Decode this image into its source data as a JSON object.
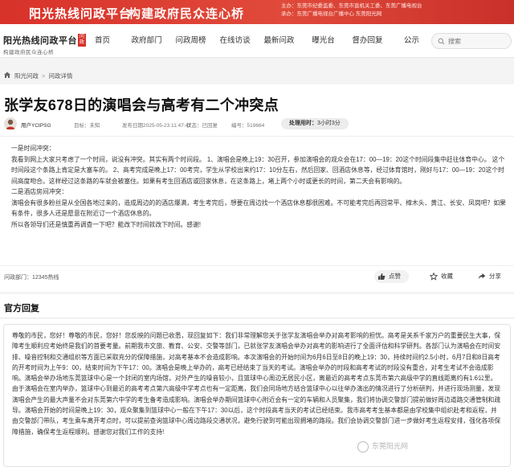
{
  "banner": {
    "title": "阳光热线问政平台",
    "slogan": "构建政府民众连心桥",
    "meta_line1": "主办：东莞市纪委监委、东莞市直机关工委、东莞广播电视台",
    "meta_line2": "承办：东莞广播电视台广播中心 东莞阳光网"
  },
  "nav": {
    "logo_name": "阳光热线问政平台",
    "logo_tag": "问政",
    "logo_sub": "构建政府民众连心桥",
    "items": [
      {
        "label": "首页"
      },
      {
        "label": "政府部门"
      },
      {
        "label": "问政周榜"
      },
      {
        "label": "在线访谈"
      },
      {
        "label": "最新问政"
      },
      {
        "label": "曝光台"
      },
      {
        "label": "督办回复"
      },
      {
        "label": "公示"
      }
    ],
    "search_placeholder": "搜索"
  },
  "breadcrumb": {
    "home": "阳光问政",
    "current": "问政详情"
  },
  "post": {
    "title": "张学友678日的演唱会与高考有二个冲突点",
    "user": "用户YCtPSG",
    "target": "目标：未知",
    "time": "发布日期2025-05-23 11:47:42",
    "status": "状态：已回复",
    "number": "编号：519664",
    "process_label": "处理用时：",
    "process_value": "3小时3分",
    "paragraphs": [
      "一是时间冲突：",
      "我看到网上大家只考虑了一个时间，说没有冲突。其实有两个时间段。 1、演唱会是晚上19：30召开，参加演唱会的观众会在17：00—19：20这个时间段集中赶往体育中心。 这个时间段这个条路上肯定是大塞车的。 2、高考完成是晚上17：00考完，学生从学校出来约17：10分左右，然后回家、回酒店休息等，经过体育馆时，刚好与17：00—19：20这个时间高度吻合。这样经过这条路的车就会被塞住。如果有考生回酒店或回家休息，在这条路上，堵上两个小时或更长的时间，第二天会有影响的。",
      "二是酒店房间冲突：",
      "演唱会有很多粉丝是从全国各地过来的，造成周边的的酒店爆满，考生考完后，想要在周边找一个酒店休息都很困难。不可能考完后再回常平、樟木头、黄江、长安、凤岗吧？如果有条件，很多人还是愿意在附近订一个酒店休息的。",
      "所以各领导们还是慎重再调查一下吧？能改下时间就改下时间。感谢!"
    ],
    "department": "问政部门：12345热线",
    "actions": {
      "like": "点赞",
      "collect": "收藏",
      "share": "分享"
    }
  },
  "reply": {
    "heading": "官方回复",
    "text": "尊敬的市民，您好！尊敬的市民，您好！您反映的问题已收悉，现回复如下：我们非常理解您关于张学友演唱会举办对高考影响的担忧。高考是关系千家万户的重要民生大事，保障考生顺利应考始终是我们的首要考量。前期我市文旅、教育、公安、交警等部门，已就张学友演唱会举办对高考的影响进行了全面评估和科学研判。各部门认为演唱会在时间安排、噪音控制和交通组织等方面已采取充分的保障措施，对高考基本不会造成影响。本次演唱会的开始时间为6月6日至8日的晚上19：30，持续时间约2.5小时，6月7日和8日高考的开考时间为上午9：00，结束时间为下午17：00。演唱会是晚上举办的，高考已经结束了当天的考试。演唱会举办的时段和高考考试的时段没有重合，对考生考试不会造成影响。演唱会举办场地东莞篮球中心是一个封闭的室内场馆，对外产生的噪音较小，且篮球中心周边无居民小区，离最近的高考考点东莞市第六高级中学的直线距离约有1.6公里。由于演唱会在室内举办，篮球中心到最近的高考考点第六高级中学考点也有一定距离，我们会同场地方结合篮球中心以往举办演出的情况进行了分析研判，并进行现场测量，发现演唱会产生的最大声量不会对东莞第六中学的考生备考造成影响。演唱会举办期间篮球中心附近会有一定的车辆和人员聚集，我们将协调交警部门提前做好周边道路交通管制和疏导。演唱会开始的时间是晚上19：30，观众聚集到篮球中心一般在下午17：30以后，这个时段高考当天的考试已经结束。我市高考考生基本都是由学校集中组织赴考和返程，并由交警部门带队，考生乘车离开考点时，可以提前查询篮球中心周边路段交通状况，避免行驶到可能出现拥堵的路段。我们会协调交警部门进一步做好考生返程安排，强化各项保障措施，确保考生返程顺利。感谢您对我们工作的支持!"
  },
  "watermark": "东莞阳光网",
  "colors": {
    "brand_red": "#d8322a",
    "page_bg": "#f4f4f4"
  }
}
